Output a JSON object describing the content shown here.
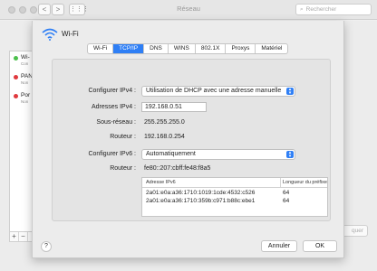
{
  "window": {
    "title": "Réseau",
    "search_placeholder": "Rechercher",
    "nav_back": "<",
    "nav_forward": ">",
    "grid_icon": "grid-icon"
  },
  "services": [
    {
      "name": "Wi-",
      "status": "Con",
      "color": "#4cc04c"
    },
    {
      "name": "PAN",
      "status": "Non",
      "color": "#e0393e"
    },
    {
      "name": "Por",
      "status": "Non",
      "color": "#e0393e"
    }
  ],
  "list_controls": {
    "add": "+",
    "remove": "−"
  },
  "bg_apply_label": "quer",
  "sheet": {
    "title": "Wi-Fi",
    "tabs": [
      "Wi-Fi",
      "TCP/IP",
      "DNS",
      "WINS",
      "802.1X",
      "Proxys",
      "Matériel"
    ],
    "active_tab": "TCP/IP",
    "ipv4": {
      "config_label": "Configurer IPv4 :",
      "config_value": "Utilisation de DHCP avec une adresse manuelle",
      "address_label": "Adresses IPv4 :",
      "address_value": "192.168.0.51",
      "subnet_label": "Sous-réseau :",
      "subnet_value": "255.255.255.0",
      "router_label": "Routeur :",
      "router_value": "192.168.0.254"
    },
    "ipv6": {
      "config_label": "Configurer IPv6 :",
      "config_value": "Automatiquement",
      "router_label": "Routeur :",
      "router_value": "fe80::207:cbff:fe48:f8a5",
      "table_headers": [
        "Adresse IPv6",
        "Longueur du préfixe"
      ],
      "rows": [
        {
          "address": "2a01:e0a:a36:1710:1019:1cde:4532:c526",
          "prefix": "64"
        },
        {
          "address": "2a01:e0a:a36:1710:359b:c971:b88c:ebe1",
          "prefix": "64"
        }
      ]
    },
    "help_label": "?",
    "cancel_label": "Annuler",
    "ok_label": "OK"
  }
}
